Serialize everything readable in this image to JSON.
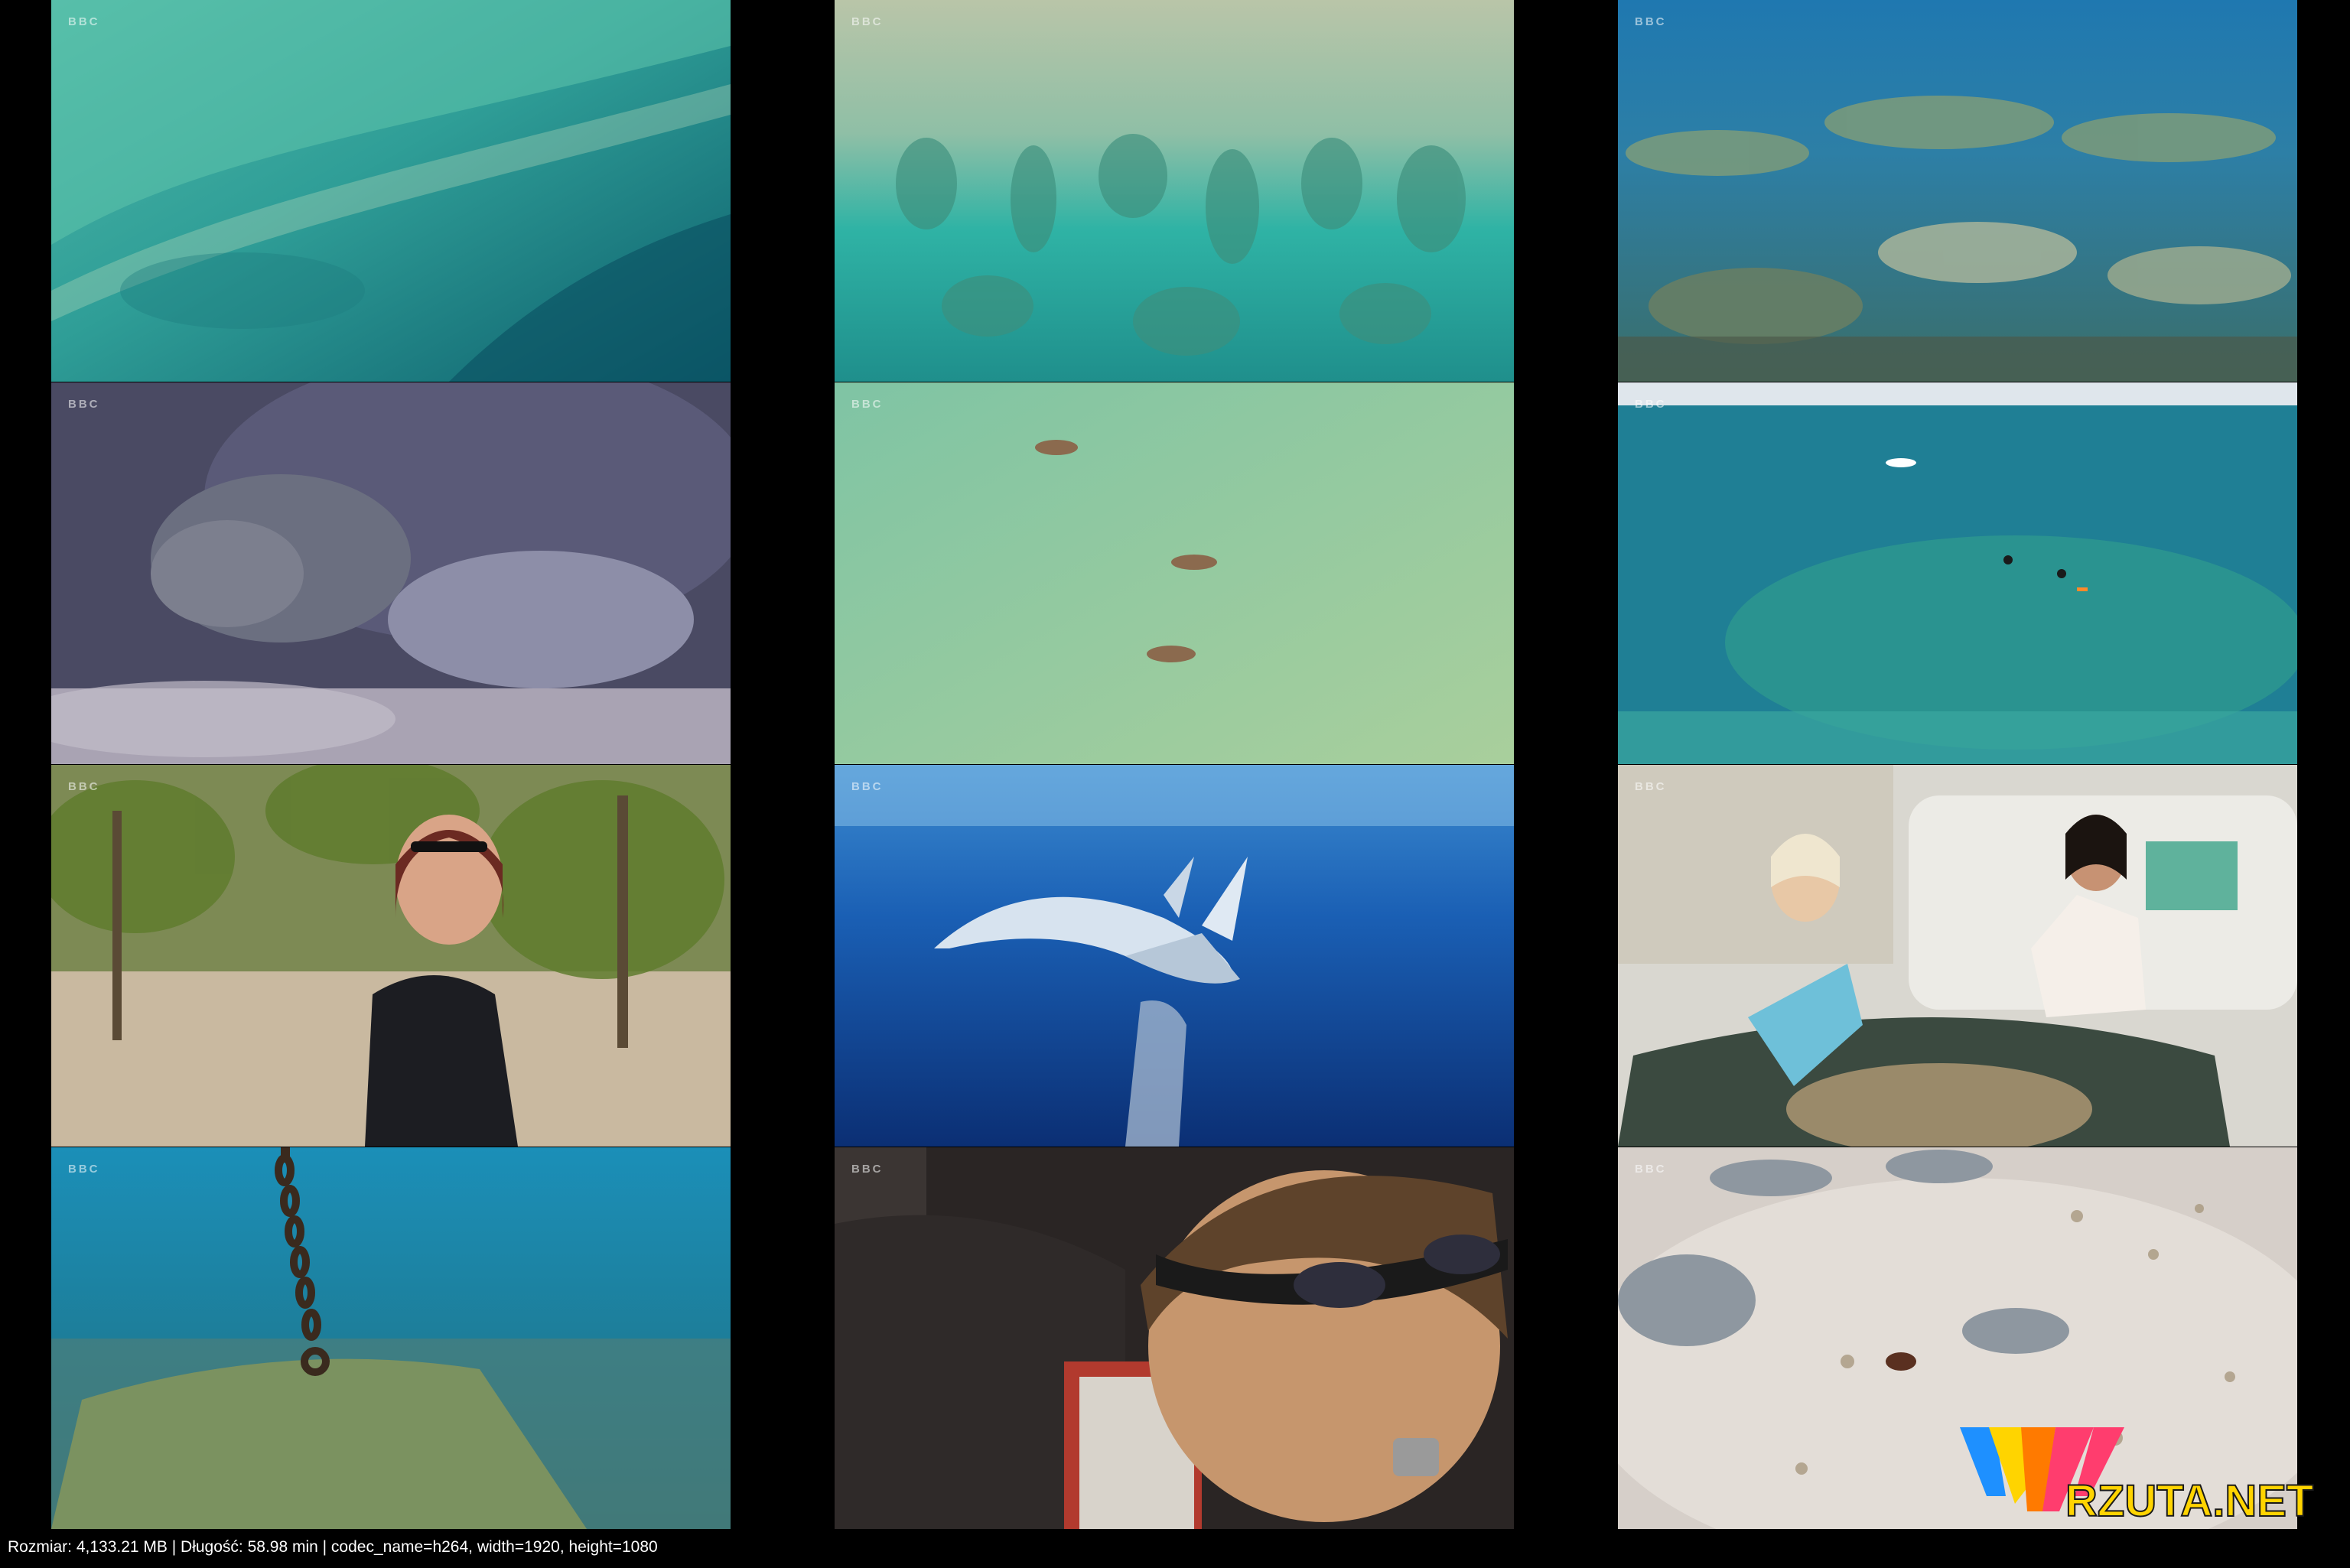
{
  "contact_sheet": {
    "footer_text": "Rozmiar: 4,133.21 MB | Długość: 58.98 min | codec_name=h264, width=1920, height=1080",
    "watermark_text": "RZUTA.NET",
    "watermark_colors": [
      "#ffd400",
      "#1e90ff",
      "#ff3d6e",
      "#ff7a00"
    ],
    "background": "#000000",
    "frames": [
      {
        "channel_logo": "BBC",
        "scene": "aerial-reef-shallows"
      },
      {
        "channel_logo": "BBC",
        "scene": "aerial-reef-edge"
      },
      {
        "channel_logo": "BBC",
        "scene": "underwater-table-corals"
      },
      {
        "channel_logo": "BBC",
        "scene": "green-turtle-closeup"
      },
      {
        "channel_logo": "BBC",
        "scene": "aerial-turtles-swimming"
      },
      {
        "channel_logo": "BBC",
        "scene": "snorkelers-on-reef"
      },
      {
        "channel_logo": "BBC",
        "scene": "researcher-interview"
      },
      {
        "channel_logo": "BBC",
        "scene": "humpback-whale-and-calf"
      },
      {
        "channel_logo": "BBC",
        "scene": "turtle-rehab-tank"
      },
      {
        "channel_logo": "BBC",
        "scene": "mooring-chain-on-seabed"
      },
      {
        "channel_logo": "BBC",
        "scene": "man-with-sunglasses"
      },
      {
        "channel_logo": "BBC",
        "scene": "turtle-hatchlings-on-sand"
      }
    ]
  }
}
